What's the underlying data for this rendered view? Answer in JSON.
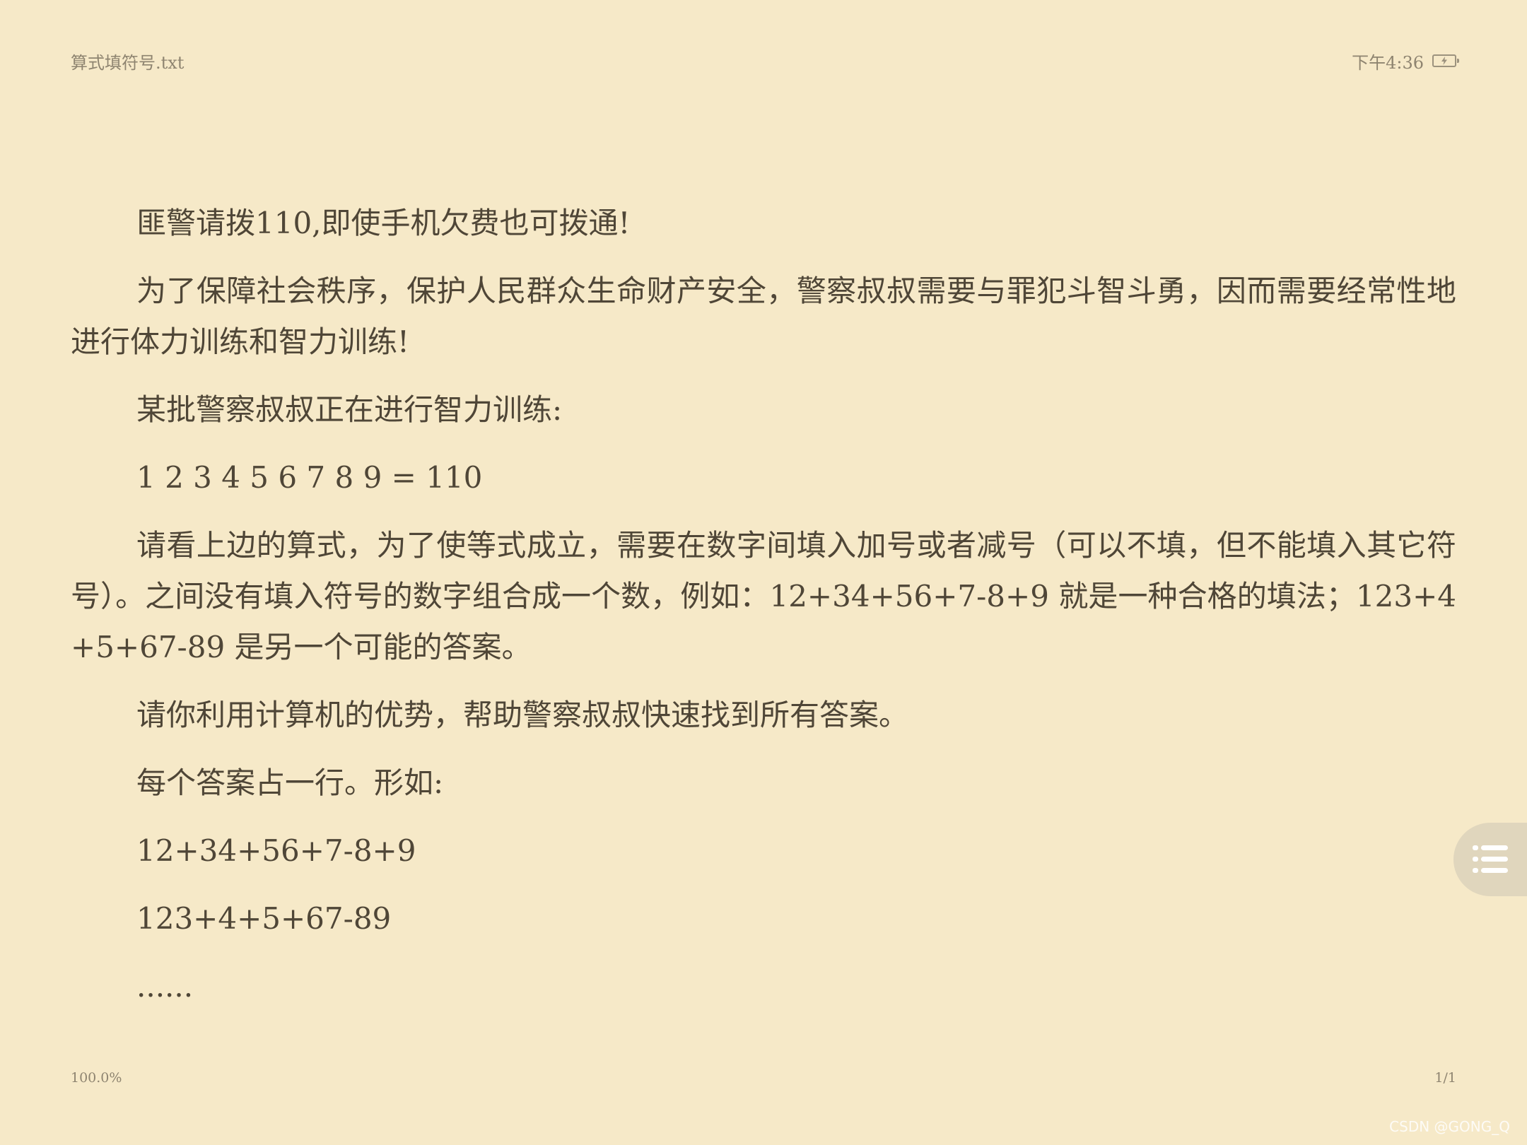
{
  "status": {
    "file_name": "算式填符号.txt",
    "time": "下午4:36",
    "battery_icon": "battery-charging-icon"
  },
  "document": {
    "paragraphs": [
      "匪警请拨110,即使手机欠费也可拨通!",
      "为了保障社会秩序，保护人民群众生命财产安全，警察叔叔需要与罪犯斗智斗勇，因而需要经常性地进行体力训练和智力训练!",
      "某批警察叔叔正在进行智力训练:",
      "1 2 3 4 5 6 7 8 9 = 110",
      "请看上边的算式，为了使等式成立，需要在数字间填入加号或者减号（可以不填，但不能填入其它符号）。之间没有填入符号的数字组合成一个数，例如：12+34+56+7-8+9 就是一种合格的填法；123+4+5+67-89 是另一个可能的答案。",
      "请你利用计算机的优势，帮助警察叔叔快速找到所有答案。",
      "每个答案占一行。形如:",
      "12+34+56+7-8+9",
      "123+4+5+67-89",
      "......"
    ]
  },
  "footer": {
    "progress": "100.0%",
    "page": "1/1"
  },
  "menu_button_icon": "list-menu-icon",
  "watermark": "CSDN @GONG_Q",
  "colors": {
    "background": "#f6e9c8",
    "text": "#4f4637",
    "muted": "#8e8470",
    "fab": "#e0d6bd"
  }
}
